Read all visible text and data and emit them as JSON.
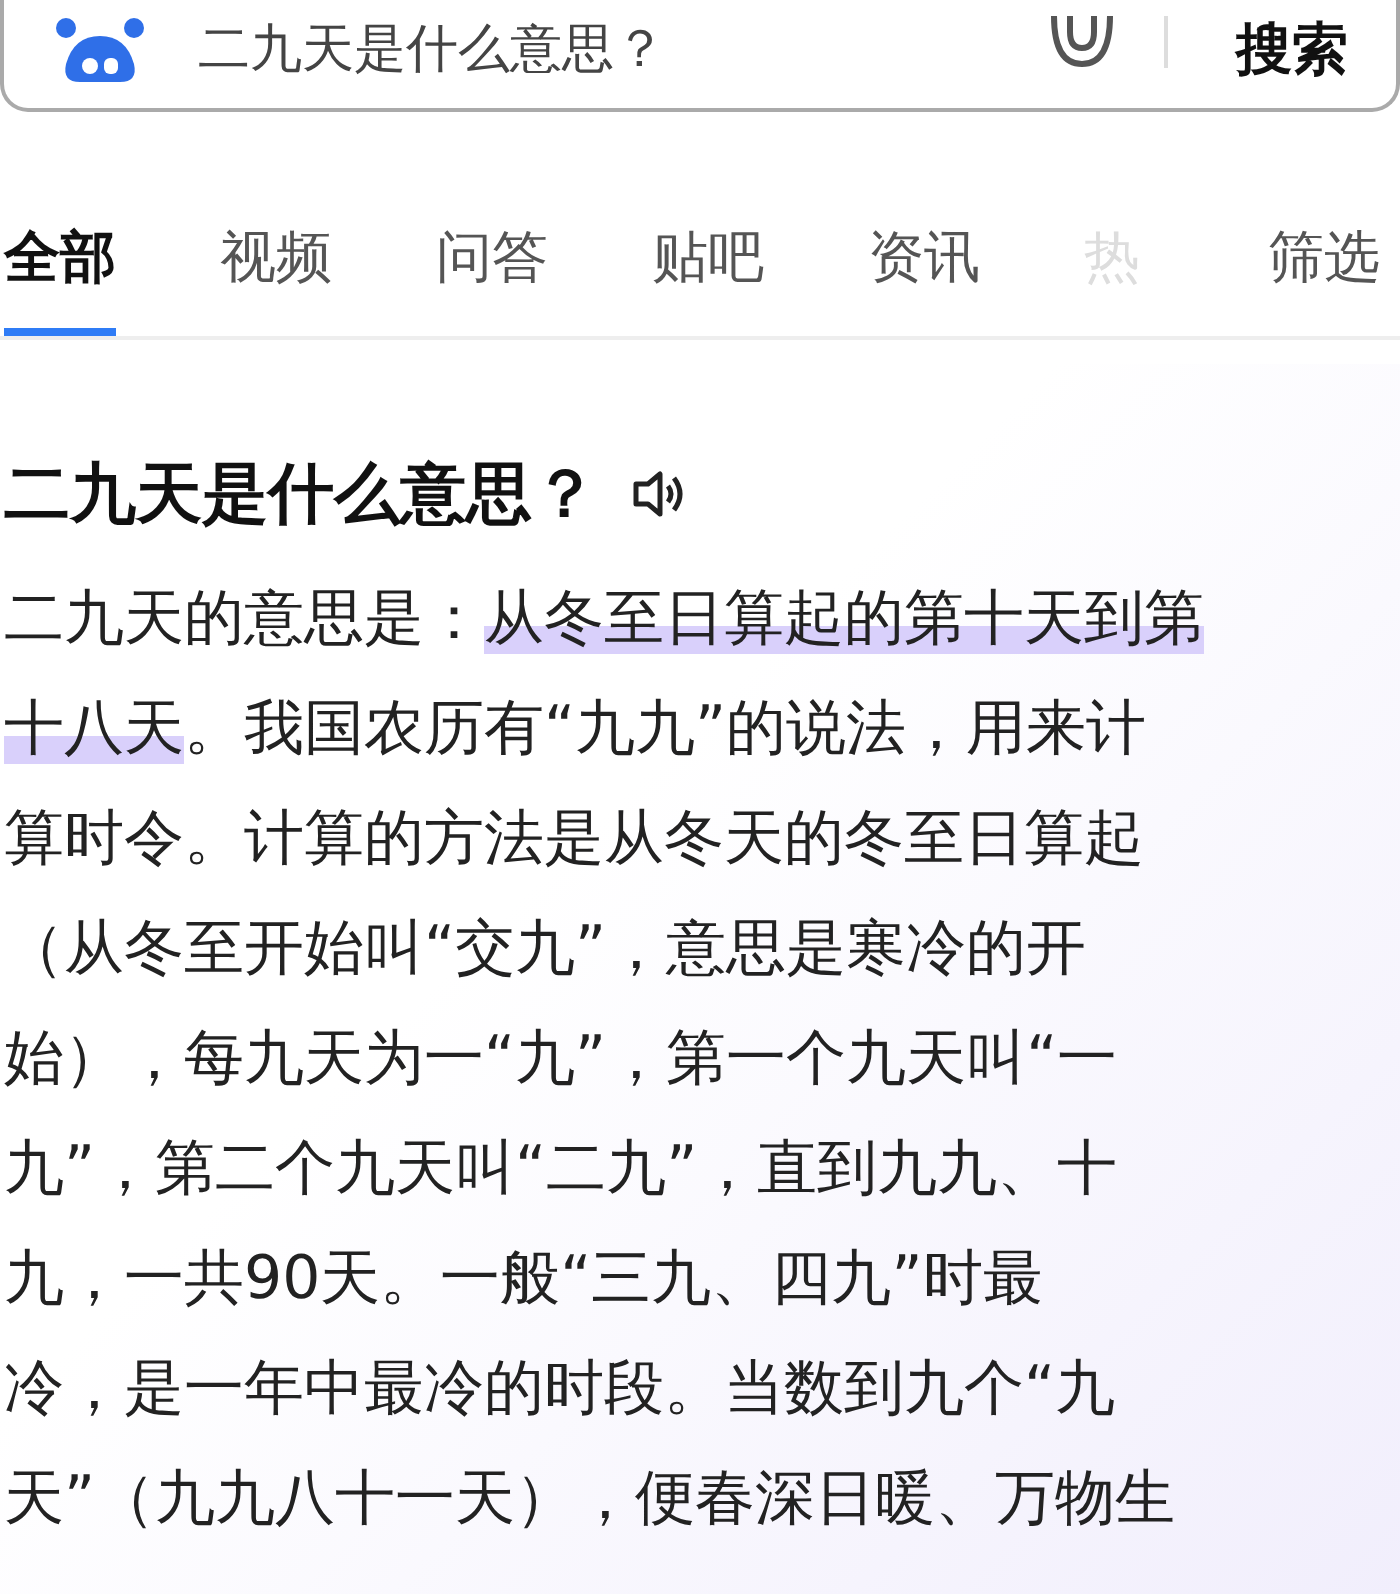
{
  "search": {
    "query": "二九天是什么意思？",
    "button": "搜索"
  },
  "tabs": [
    {
      "label": "全部",
      "selected": true,
      "faded": false
    },
    {
      "label": "视频",
      "selected": false,
      "faded": false
    },
    {
      "label": "问答",
      "selected": false,
      "faded": false
    },
    {
      "label": "贴吧",
      "selected": false,
      "faded": false
    },
    {
      "label": "资讯",
      "selected": false,
      "faded": false
    },
    {
      "label": "热",
      "selected": false,
      "faded": true
    }
  ],
  "filter": "筛选",
  "answer": {
    "title": "二九天是什么意思？",
    "lines": [
      [
        {
          "text": "二九天的意思是：",
          "highlight": false
        },
        {
          "text": "从冬至日算起的第十天到第",
          "highlight": true
        }
      ],
      [
        {
          "text": "十八天",
          "highlight": true
        },
        {
          "text": "。我国农历有“九九”的说法，用来计",
          "highlight": false
        }
      ],
      [
        {
          "text": "算时令。计算的方法是从冬天的冬至日算起",
          "highlight": false
        }
      ],
      [
        {
          "text": "（从冬至开始叫“交九”，意思是寒冷的开",
          "highlight": false
        }
      ],
      [
        {
          "text": "始），每九天为一“九”，第一个九天叫“一",
          "highlight": false
        }
      ],
      [
        {
          "text": "九”，第二个九天叫“二九”，直到九九、十",
          "highlight": false
        }
      ],
      [
        {
          "text": "九，一共90天。一般“三九、四九”时最",
          "highlight": false
        }
      ],
      [
        {
          "text": "冷，是一年中最冷的时段。当数到九个“九",
          "highlight": false
        }
      ],
      [
        {
          "text": "天”（九九八十一天），便春深日暖、万物生",
          "highlight": false
        }
      ]
    ]
  }
}
